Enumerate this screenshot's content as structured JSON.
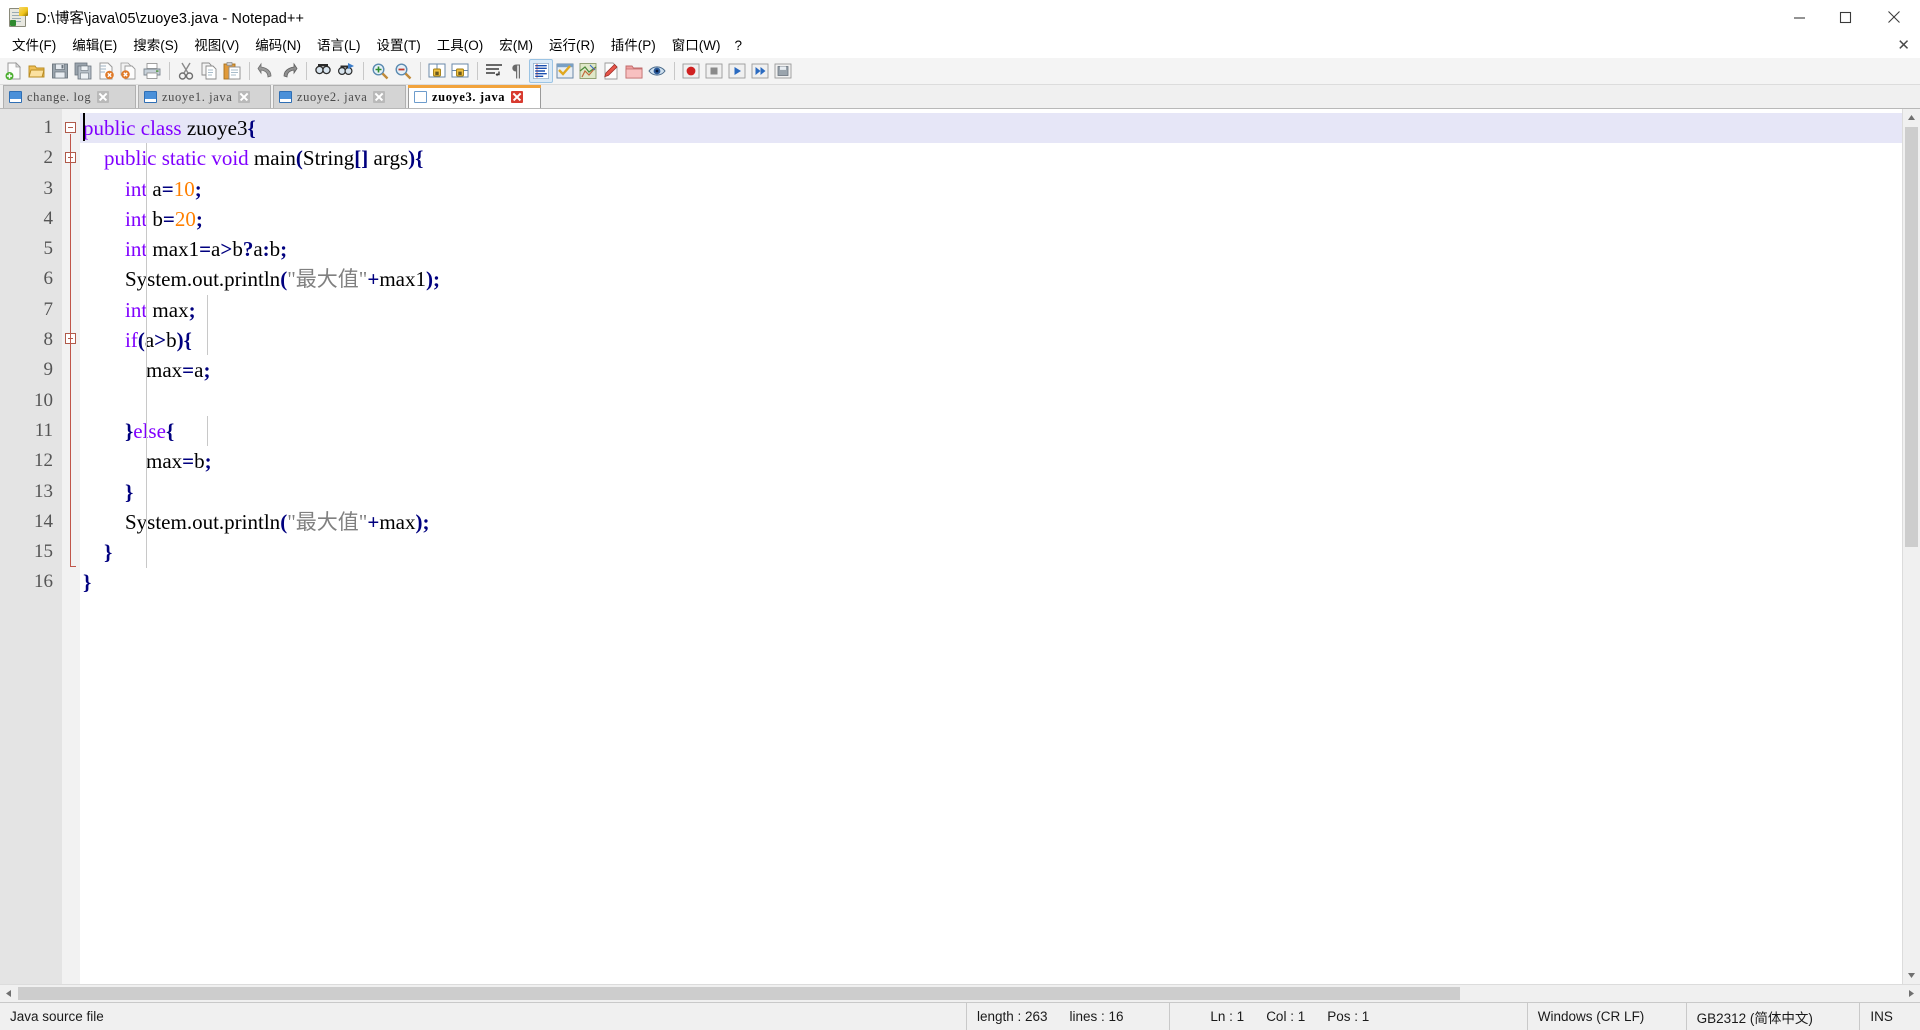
{
  "window": {
    "title": "D:\\博客\\java\\05\\zuoye3.java - Notepad++",
    "icon": "notepad-plus-plus-icon",
    "minimize_label": "—",
    "maximize_label": "▢",
    "close_label": "✕"
  },
  "menu": {
    "items": [
      {
        "label": "文件(F)",
        "name": "menu-file"
      },
      {
        "label": "编辑(E)",
        "name": "menu-edit"
      },
      {
        "label": "搜索(S)",
        "name": "menu-search"
      },
      {
        "label": "视图(V)",
        "name": "menu-view"
      },
      {
        "label": "编码(N)",
        "name": "menu-encoding"
      },
      {
        "label": "语言(L)",
        "name": "menu-language"
      },
      {
        "label": "设置(T)",
        "name": "menu-settings"
      },
      {
        "label": "工具(O)",
        "name": "menu-tools"
      },
      {
        "label": "宏(M)",
        "name": "menu-macro"
      },
      {
        "label": "运行(R)",
        "name": "menu-run"
      },
      {
        "label": "插件(P)",
        "name": "menu-plugins"
      },
      {
        "label": "窗口(W)",
        "name": "menu-window"
      },
      {
        "label": "?",
        "name": "menu-help"
      }
    ],
    "close_document": "✕"
  },
  "toolbar": {
    "buttons": [
      {
        "name": "new-file-icon",
        "title": "新建"
      },
      {
        "name": "open-file-icon",
        "title": "打开"
      },
      {
        "name": "save-icon",
        "title": "保存"
      },
      {
        "name": "save-all-icon",
        "title": "保存所有"
      },
      {
        "name": "close-file-icon",
        "title": "关闭"
      },
      {
        "name": "close-all-icon",
        "title": "关闭所有"
      },
      {
        "name": "print-icon",
        "title": "打印"
      },
      {
        "name": "cut-icon",
        "title": "剪切"
      },
      {
        "name": "copy-icon",
        "title": "复制"
      },
      {
        "name": "paste-icon",
        "title": "粘贴"
      },
      {
        "name": "undo-icon",
        "title": "撤销"
      },
      {
        "name": "redo-icon",
        "title": "重做"
      },
      {
        "name": "find-icon",
        "title": "查找"
      },
      {
        "name": "replace-icon",
        "title": "替换"
      },
      {
        "name": "zoom-in-icon",
        "title": "放大"
      },
      {
        "name": "zoom-out-icon",
        "title": "缩小"
      },
      {
        "name": "sync-vertical-icon",
        "title": "同步垂直滚动"
      },
      {
        "name": "sync-horizontal-icon",
        "title": "同步水平滚动"
      },
      {
        "name": "word-wrap-icon",
        "title": "自动换行"
      },
      {
        "name": "show-all-chars-icon",
        "title": "显示所有字符"
      },
      {
        "name": "indent-guide-icon",
        "title": "显示缩进参考线"
      },
      {
        "name": "user-define-dialog-icon",
        "title": "用户自定义语言"
      },
      {
        "name": "document-map-icon",
        "title": "文档地图"
      },
      {
        "name": "function-list-icon",
        "title": "函数列表"
      },
      {
        "name": "folder-as-workspace-icon",
        "title": "文件夹作为工作区"
      },
      {
        "name": "monitoring-icon",
        "title": "文档监视"
      },
      {
        "name": "macro-record-icon",
        "title": "开始录制"
      },
      {
        "name": "macro-stop-icon",
        "title": "停止录制"
      },
      {
        "name": "macro-play-icon",
        "title": "播放"
      },
      {
        "name": "macro-playmultiple-icon",
        "title": "多次运行宏"
      },
      {
        "name": "macro-save-icon",
        "title": "保存当前录制的宏"
      }
    ],
    "selected_index": 20
  },
  "tabs": [
    {
      "label": "change. log",
      "active": false,
      "name": "tab-change-log"
    },
    {
      "label": "zuoye1. java",
      "active": false,
      "name": "tab-zuoye1"
    },
    {
      "label": "zuoye2. java",
      "active": false,
      "name": "tab-zuoye2"
    },
    {
      "label": "zuoye3. java",
      "active": true,
      "name": "tab-zuoye3"
    }
  ],
  "editor": {
    "line_numbers": [
      1,
      2,
      3,
      4,
      5,
      6,
      7,
      8,
      9,
      10,
      11,
      12,
      13,
      14,
      15,
      16
    ],
    "current_line": 1,
    "lines": [
      {
        "n": 1,
        "tokens": [
          {
            "t": "public",
            "c": "kw"
          },
          {
            "t": " ",
            "c": "id"
          },
          {
            "t": "class",
            "c": "kw"
          },
          {
            "t": " ",
            "c": "id"
          },
          {
            "t": "zuoye3",
            "c": "id"
          },
          {
            "t": "{",
            "c": "op"
          }
        ]
      },
      {
        "n": 2,
        "tokens": [
          {
            "t": "    ",
            "c": "id"
          },
          {
            "t": "public",
            "c": "kw"
          },
          {
            "t": " ",
            "c": "id"
          },
          {
            "t": "static",
            "c": "kw"
          },
          {
            "t": " ",
            "c": "id"
          },
          {
            "t": "void",
            "c": "kw"
          },
          {
            "t": " ",
            "c": "id"
          },
          {
            "t": "main",
            "c": "id"
          },
          {
            "t": "(",
            "c": "op"
          },
          {
            "t": "String",
            "c": "id"
          },
          {
            "t": "[]",
            "c": "op"
          },
          {
            "t": " args",
            "c": "id"
          },
          {
            "t": ")",
            "c": "op"
          },
          {
            "t": "{",
            "c": "op"
          }
        ]
      },
      {
        "n": 3,
        "tokens": [
          {
            "t": "        ",
            "c": "id"
          },
          {
            "t": "int",
            "c": "kw"
          },
          {
            "t": " a",
            "c": "id"
          },
          {
            "t": "=",
            "c": "op"
          },
          {
            "t": "10",
            "c": "num"
          },
          {
            "t": ";",
            "c": "op"
          }
        ]
      },
      {
        "n": 4,
        "tokens": [
          {
            "t": "        ",
            "c": "id"
          },
          {
            "t": "int",
            "c": "kw"
          },
          {
            "t": " b",
            "c": "id"
          },
          {
            "t": "=",
            "c": "op"
          },
          {
            "t": "20",
            "c": "num"
          },
          {
            "t": ";",
            "c": "op"
          }
        ]
      },
      {
        "n": 5,
        "tokens": [
          {
            "t": "        ",
            "c": "id"
          },
          {
            "t": "int",
            "c": "kw"
          },
          {
            "t": " max1",
            "c": "id"
          },
          {
            "t": "=",
            "c": "op"
          },
          {
            "t": "a",
            "c": "id"
          },
          {
            "t": ">",
            "c": "op"
          },
          {
            "t": "b",
            "c": "id"
          },
          {
            "t": "?",
            "c": "op"
          },
          {
            "t": "a",
            "c": "id"
          },
          {
            "t": ":",
            "c": "op"
          },
          {
            "t": "b",
            "c": "id"
          },
          {
            "t": ";",
            "c": "op"
          }
        ]
      },
      {
        "n": 6,
        "tokens": [
          {
            "t": "        ",
            "c": "id"
          },
          {
            "t": "System.out.println",
            "c": "id"
          },
          {
            "t": "(",
            "c": "op"
          },
          {
            "t": "\"最大值\"",
            "c": "str"
          },
          {
            "t": "+",
            "c": "op"
          },
          {
            "t": "max1",
            "c": "id"
          },
          {
            "t": ")",
            "c": "op"
          },
          {
            "t": ";",
            "c": "op"
          }
        ]
      },
      {
        "n": 7,
        "tokens": [
          {
            "t": "        ",
            "c": "id"
          },
          {
            "t": "int",
            "c": "kw"
          },
          {
            "t": " max",
            "c": "id"
          },
          {
            "t": ";",
            "c": "op"
          }
        ]
      },
      {
        "n": 8,
        "tokens": [
          {
            "t": "        ",
            "c": "id"
          },
          {
            "t": "if",
            "c": "kw"
          },
          {
            "t": "(",
            "c": "op"
          },
          {
            "t": "a",
            "c": "id"
          },
          {
            "t": ">",
            "c": "op"
          },
          {
            "t": "b",
            "c": "id"
          },
          {
            "t": ")",
            "c": "op"
          },
          {
            "t": "{",
            "c": "op"
          }
        ]
      },
      {
        "n": 9,
        "tokens": [
          {
            "t": "            ",
            "c": "id"
          },
          {
            "t": "max",
            "c": "id"
          },
          {
            "t": "=",
            "c": "op"
          },
          {
            "t": "a",
            "c": "id"
          },
          {
            "t": ";",
            "c": "op"
          }
        ]
      },
      {
        "n": 10,
        "tokens": [
          {
            "t": "",
            "c": "id"
          }
        ]
      },
      {
        "n": 11,
        "tokens": [
          {
            "t": "        ",
            "c": "id"
          },
          {
            "t": "}",
            "c": "op"
          },
          {
            "t": "else",
            "c": "kw"
          },
          {
            "t": "{",
            "c": "op"
          }
        ]
      },
      {
        "n": 12,
        "tokens": [
          {
            "t": "            ",
            "c": "id"
          },
          {
            "t": "max",
            "c": "id"
          },
          {
            "t": "=",
            "c": "op"
          },
          {
            "t": "b",
            "c": "id"
          },
          {
            "t": ";",
            "c": "op"
          }
        ]
      },
      {
        "n": 13,
        "tokens": [
          {
            "t": "        ",
            "c": "id"
          },
          {
            "t": "}",
            "c": "op"
          }
        ]
      },
      {
        "n": 14,
        "tokens": [
          {
            "t": "        ",
            "c": "id"
          },
          {
            "t": "System.out.println",
            "c": "id"
          },
          {
            "t": "(",
            "c": "op"
          },
          {
            "t": "\"最大值\"",
            "c": "str"
          },
          {
            "t": "+",
            "c": "op"
          },
          {
            "t": "max",
            "c": "id"
          },
          {
            "t": ")",
            "c": "op"
          },
          {
            "t": ";",
            "c": "op"
          }
        ]
      },
      {
        "n": 15,
        "tokens": [
          {
            "t": "    ",
            "c": "id"
          },
          {
            "t": "}",
            "c": "op"
          }
        ]
      },
      {
        "n": 16,
        "tokens": [
          {
            "t": "}",
            "c": "op"
          }
        ]
      }
    ],
    "colors": {
      "keyword": "#8000ff",
      "number": "#ff8000",
      "string": "#808080",
      "operator": "#00007f",
      "identifier": "#000000",
      "current_line_bg": "#e6e6f7",
      "gutter_bg": "#e4e4e4",
      "fold_marker": "#c0564a",
      "active_tab_bar": "#f2a33c"
    }
  },
  "statusbar": {
    "file_type": "Java source file",
    "length_label": "length : 263",
    "lines_label": "lines : 16",
    "ln": "Ln : 1",
    "col": "Col : 1",
    "pos": "Pos : 1",
    "eol": "Windows (CR LF)",
    "encoding": "GB2312 (简体中文)",
    "insert_mode": "INS"
  }
}
